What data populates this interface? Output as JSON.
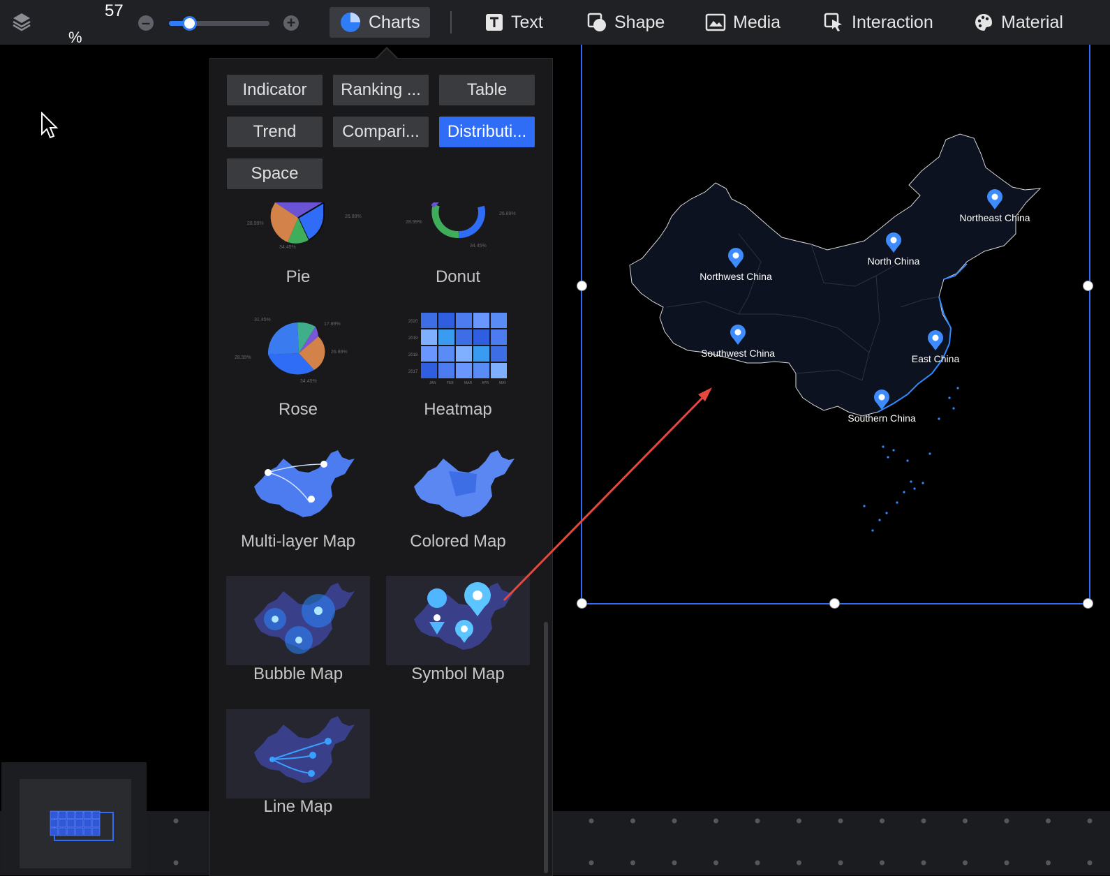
{
  "toolbar": {
    "zoom_value": "57",
    "zoom_unit": "%",
    "zoom_slider_fraction": 0.2,
    "items": [
      {
        "label": "Charts",
        "icon": "pie-chart-icon",
        "active": true
      },
      {
        "label": "Text",
        "icon": "text-icon"
      },
      {
        "label": "Shape",
        "icon": "shape-icon"
      },
      {
        "label": "Media",
        "icon": "media-icon"
      },
      {
        "label": "Interaction",
        "icon": "interaction-icon"
      },
      {
        "label": "Material",
        "icon": "palette-icon"
      }
    ]
  },
  "panel": {
    "categories": [
      {
        "label": "Indicator"
      },
      {
        "label": "Ranking ..."
      },
      {
        "label": "Table"
      },
      {
        "label": "Trend"
      },
      {
        "label": "Compari..."
      },
      {
        "label": "Distributi...",
        "active": true
      },
      {
        "label": "Space"
      }
    ],
    "charts": [
      {
        "label": "Pie"
      },
      {
        "label": "Donut"
      },
      {
        "label": "Rose"
      },
      {
        "label": "Heatmap"
      },
      {
        "label": "Multi-layer Map"
      },
      {
        "label": "Colored Map"
      },
      {
        "label": "Bubble Map"
      },
      {
        "label": "Symbol Map"
      },
      {
        "label": "Line Map"
      }
    ],
    "thumb_text": {
      "pie": [
        "28.99%",
        "26.89%",
        "34.45%"
      ],
      "donut": [
        "28.99%",
        "26.89%",
        "34.45%"
      ],
      "rose": [
        "31.45%",
        "17.89%",
        "28.99%",
        "26.89%",
        "34.45%"
      ],
      "heatmap_years": [
        "2020",
        "2019",
        "2018",
        "2017"
      ],
      "heatmap_months": [
        "JAN",
        "FEB",
        "MAR",
        "APR",
        "MAY"
      ]
    }
  },
  "canvas": {
    "regions": [
      {
        "label": "Northeast China"
      },
      {
        "label": "North China"
      },
      {
        "label": "Northwest China"
      },
      {
        "label": "Southwest China"
      },
      {
        "label": "East China"
      },
      {
        "label": "Southern China"
      }
    ]
  },
  "colors": {
    "accent": "#2f6df6",
    "annotation_arrow": "#e5483f",
    "pin": "#3d8bfd",
    "map_fill": "#0c1220",
    "coast": "#2f8cff"
  }
}
